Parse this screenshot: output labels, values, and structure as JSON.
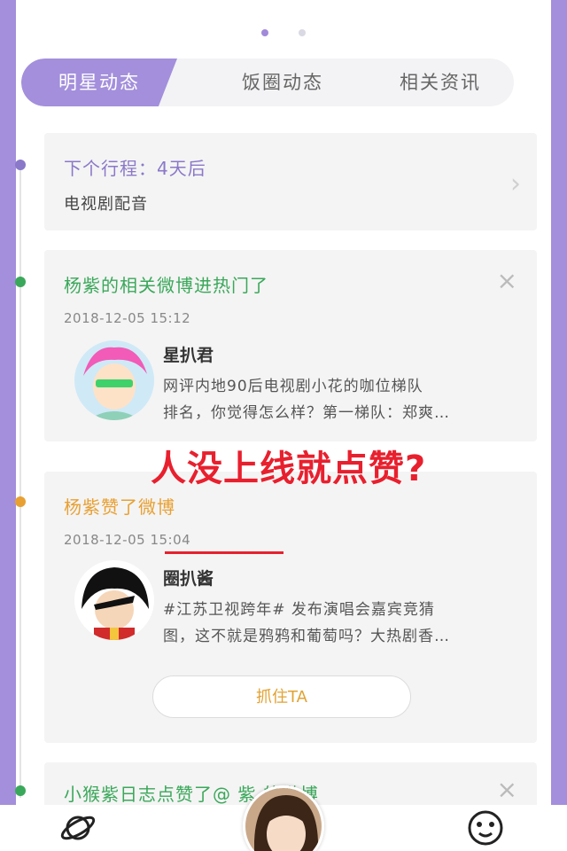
{
  "tabs": [
    {
      "label": "明星动态",
      "active": true
    },
    {
      "label": "饭圈动态",
      "active": false
    },
    {
      "label": "相关资讯",
      "active": false
    }
  ],
  "next_schedule": {
    "title": "下个行程：4天后",
    "subtitle": "电视剧配音"
  },
  "feed": [
    {
      "header": "杨紫的相关微博进热门了",
      "time": "2018-12-05  15:12",
      "user": "星扒君",
      "text_line1": "网评内地90后电视剧小花的咖位梯队",
      "text_line2": "排名，你觉得怎么样？第一梯队：郑爽…"
    },
    {
      "header": "杨紫赞了微博",
      "time": "2018-12-05  15:04",
      "user": "圈扒酱",
      "text_line1": "#江苏卫视跨年# 发布演唱会嘉宾竞猜",
      "text_line2": "图，这不就是鸦鸦和葡萄吗？大热剧香…",
      "button": "抓住TA"
    },
    {
      "header": "小猴紫日志点赞了@    紫  的微博"
    }
  ],
  "overlay_text": "人没上线就点赞?",
  "colors": {
    "accent": "#a38fdc",
    "green": "#3aa85a",
    "orange": "#e8a032",
    "red_annotation": "#e8202e"
  },
  "icons": [
    "planet-icon",
    "smiley-icon",
    "close-icon",
    "chevron-right-icon"
  ]
}
